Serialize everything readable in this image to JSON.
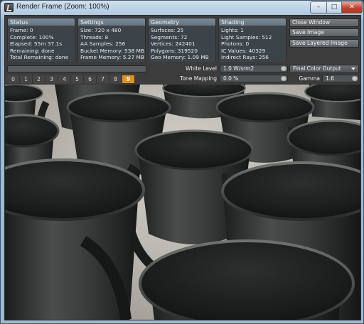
{
  "window": {
    "title": "Render Frame (Zoom: 100%)",
    "minimize_glyph": "–",
    "maximize_glyph": "□",
    "close_glyph": "✕"
  },
  "status": {
    "header": "Status",
    "frame": "Frame: 0",
    "complete": "Complete: 100%",
    "elapsed": "Elapsed: 55m 37.1s",
    "remaining": "Remaining: done",
    "total_remaining": "Total Remaining: done"
  },
  "settings": {
    "header": "Settings",
    "size": "Size: 720 x 480",
    "threads": "Threads: 8",
    "aa_samples": "AA Samples: 256",
    "bucket_memory": "Bucket Memory: 538 MB",
    "frame_memory": "Frame Memory: 5.27 MB"
  },
  "geometry": {
    "header": "Geometry",
    "surfaces": "Surfaces: 25",
    "segments": "Segments: 72",
    "vertices": "Vertices: 242401",
    "polygons": "Polygons: 319520",
    "geo_memory": "Geo Memory: 1.09 MB"
  },
  "shading": {
    "header": "Shading",
    "lights": "Lights: 1",
    "light_samples": "Light Samples: 512",
    "photons": "Photons: 0",
    "ic_values": "IC Values: 40329",
    "indirect_rays": "Indirect Rays: 256"
  },
  "actions": {
    "close_window": "Close Window",
    "save_image": "Save Image",
    "save_layered_image": "Save Layered Image"
  },
  "buffers": [
    "0",
    "1",
    "2",
    "3",
    "4",
    "5",
    "6",
    "7",
    "8",
    "9"
  ],
  "active_buffer": "9",
  "controls": {
    "white_level_label": "White Level",
    "white_level_value": "1.0 W/srm2",
    "tone_mapping_label": "Tone Mapping",
    "tone_mapping_value": "0.0 %",
    "output_selected": "Final Color Output",
    "gamma_label": "Gamma",
    "gamma_value": "1.6"
  },
  "colors": {
    "active_buffer": "#e2921b",
    "panel_header": "#6f7e89",
    "close_button": "#c2402a"
  }
}
